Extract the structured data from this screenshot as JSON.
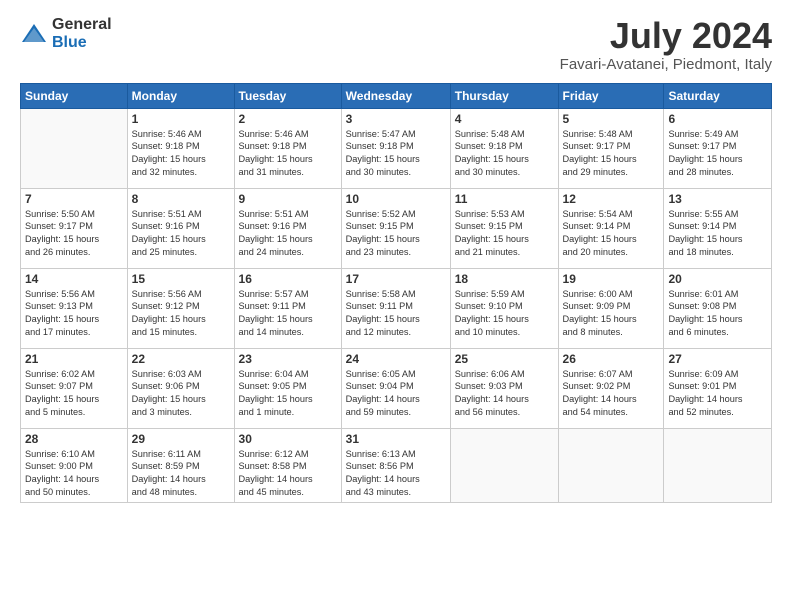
{
  "logo": {
    "general": "General",
    "blue": "Blue"
  },
  "title": {
    "month_year": "July 2024",
    "location": "Favari-Avatanei, Piedmont, Italy"
  },
  "weekdays": [
    "Sunday",
    "Monday",
    "Tuesday",
    "Wednesday",
    "Thursday",
    "Friday",
    "Saturday"
  ],
  "weeks": [
    [
      {
        "day": "",
        "info": ""
      },
      {
        "day": "1",
        "info": "Sunrise: 5:46 AM\nSunset: 9:18 PM\nDaylight: 15 hours\nand 32 minutes."
      },
      {
        "day": "2",
        "info": "Sunrise: 5:46 AM\nSunset: 9:18 PM\nDaylight: 15 hours\nand 31 minutes."
      },
      {
        "day": "3",
        "info": "Sunrise: 5:47 AM\nSunset: 9:18 PM\nDaylight: 15 hours\nand 30 minutes."
      },
      {
        "day": "4",
        "info": "Sunrise: 5:48 AM\nSunset: 9:18 PM\nDaylight: 15 hours\nand 30 minutes."
      },
      {
        "day": "5",
        "info": "Sunrise: 5:48 AM\nSunset: 9:17 PM\nDaylight: 15 hours\nand 29 minutes."
      },
      {
        "day": "6",
        "info": "Sunrise: 5:49 AM\nSunset: 9:17 PM\nDaylight: 15 hours\nand 28 minutes."
      }
    ],
    [
      {
        "day": "7",
        "info": "Sunrise: 5:50 AM\nSunset: 9:17 PM\nDaylight: 15 hours\nand 26 minutes."
      },
      {
        "day": "8",
        "info": "Sunrise: 5:51 AM\nSunset: 9:16 PM\nDaylight: 15 hours\nand 25 minutes."
      },
      {
        "day": "9",
        "info": "Sunrise: 5:51 AM\nSunset: 9:16 PM\nDaylight: 15 hours\nand 24 minutes."
      },
      {
        "day": "10",
        "info": "Sunrise: 5:52 AM\nSunset: 9:15 PM\nDaylight: 15 hours\nand 23 minutes."
      },
      {
        "day": "11",
        "info": "Sunrise: 5:53 AM\nSunset: 9:15 PM\nDaylight: 15 hours\nand 21 minutes."
      },
      {
        "day": "12",
        "info": "Sunrise: 5:54 AM\nSunset: 9:14 PM\nDaylight: 15 hours\nand 20 minutes."
      },
      {
        "day": "13",
        "info": "Sunrise: 5:55 AM\nSunset: 9:14 PM\nDaylight: 15 hours\nand 18 minutes."
      }
    ],
    [
      {
        "day": "14",
        "info": "Sunrise: 5:56 AM\nSunset: 9:13 PM\nDaylight: 15 hours\nand 17 minutes."
      },
      {
        "day": "15",
        "info": "Sunrise: 5:56 AM\nSunset: 9:12 PM\nDaylight: 15 hours\nand 15 minutes."
      },
      {
        "day": "16",
        "info": "Sunrise: 5:57 AM\nSunset: 9:11 PM\nDaylight: 15 hours\nand 14 minutes."
      },
      {
        "day": "17",
        "info": "Sunrise: 5:58 AM\nSunset: 9:11 PM\nDaylight: 15 hours\nand 12 minutes."
      },
      {
        "day": "18",
        "info": "Sunrise: 5:59 AM\nSunset: 9:10 PM\nDaylight: 15 hours\nand 10 minutes."
      },
      {
        "day": "19",
        "info": "Sunrise: 6:00 AM\nSunset: 9:09 PM\nDaylight: 15 hours\nand 8 minutes."
      },
      {
        "day": "20",
        "info": "Sunrise: 6:01 AM\nSunset: 9:08 PM\nDaylight: 15 hours\nand 6 minutes."
      }
    ],
    [
      {
        "day": "21",
        "info": "Sunrise: 6:02 AM\nSunset: 9:07 PM\nDaylight: 15 hours\nand 5 minutes."
      },
      {
        "day": "22",
        "info": "Sunrise: 6:03 AM\nSunset: 9:06 PM\nDaylight: 15 hours\nand 3 minutes."
      },
      {
        "day": "23",
        "info": "Sunrise: 6:04 AM\nSunset: 9:05 PM\nDaylight: 15 hours\nand 1 minute."
      },
      {
        "day": "24",
        "info": "Sunrise: 6:05 AM\nSunset: 9:04 PM\nDaylight: 14 hours\nand 59 minutes."
      },
      {
        "day": "25",
        "info": "Sunrise: 6:06 AM\nSunset: 9:03 PM\nDaylight: 14 hours\nand 56 minutes."
      },
      {
        "day": "26",
        "info": "Sunrise: 6:07 AM\nSunset: 9:02 PM\nDaylight: 14 hours\nand 54 minutes."
      },
      {
        "day": "27",
        "info": "Sunrise: 6:09 AM\nSunset: 9:01 PM\nDaylight: 14 hours\nand 52 minutes."
      }
    ],
    [
      {
        "day": "28",
        "info": "Sunrise: 6:10 AM\nSunset: 9:00 PM\nDaylight: 14 hours\nand 50 minutes."
      },
      {
        "day": "29",
        "info": "Sunrise: 6:11 AM\nSunset: 8:59 PM\nDaylight: 14 hours\nand 48 minutes."
      },
      {
        "day": "30",
        "info": "Sunrise: 6:12 AM\nSunset: 8:58 PM\nDaylight: 14 hours\nand 45 minutes."
      },
      {
        "day": "31",
        "info": "Sunrise: 6:13 AM\nSunset: 8:56 PM\nDaylight: 14 hours\nand 43 minutes."
      },
      {
        "day": "",
        "info": ""
      },
      {
        "day": "",
        "info": ""
      },
      {
        "day": "",
        "info": ""
      }
    ]
  ]
}
